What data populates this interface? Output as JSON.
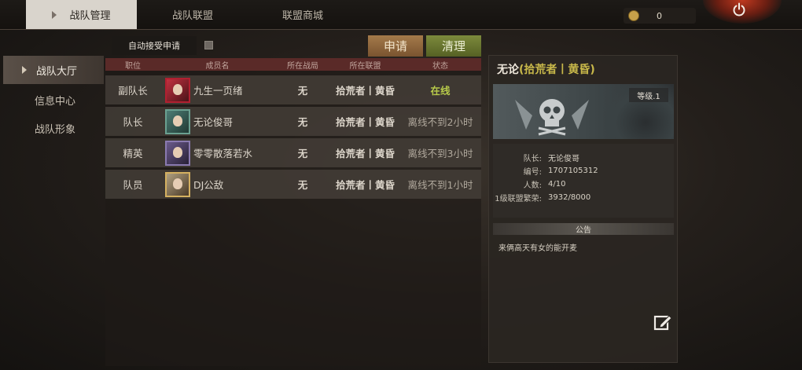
{
  "top_tabs": [
    {
      "label": "战队管理",
      "active": true
    },
    {
      "label": "战队联盟",
      "active": false
    },
    {
      "label": "联盟商城",
      "active": false
    }
  ],
  "currency": {
    "value": "0",
    "icon": "coin-icon"
  },
  "power_icon": "power-icon",
  "sidebar": {
    "items": [
      {
        "label": "战队大厅",
        "active": true
      },
      {
        "label": "信息中心",
        "active": false
      },
      {
        "label": "战队形象",
        "active": false
      }
    ]
  },
  "toolbar": {
    "auto_accept_label": "自动接受申请",
    "auto_accept_checked": false,
    "apply_label": "申请",
    "clear_label": "清理"
  },
  "table": {
    "headers": [
      "职位",
      "成员名",
      "所在战局",
      "所在联盟",
      "状态"
    ],
    "rows": [
      {
        "position": "副队长",
        "name": "九生一页绪",
        "battle": "无",
        "alliance": "拾荒者丨黄昏",
        "status": "在线",
        "online": true
      },
      {
        "position": "队长",
        "name": "无论俊哥",
        "battle": "无",
        "alliance": "拾荒者丨黄昏",
        "status": "离线不到2小时",
        "online": false
      },
      {
        "position": "精英",
        "name": "零零散落若水",
        "battle": "无",
        "alliance": "拾荒者丨黄昏",
        "status": "离线不到3小时",
        "online": false
      },
      {
        "position": "队员",
        "name": "DJ公敌",
        "battle": "无",
        "alliance": "拾荒者丨黄昏",
        "status": "离线不到1小时",
        "online": false
      }
    ]
  },
  "team_panel": {
    "team_name": "无论",
    "alliance_tag": "(拾荒者丨黄昏)",
    "level": "等级.1",
    "info": [
      {
        "label": "队长:",
        "value": "无论俊哥"
      },
      {
        "label": "编号:",
        "value": "1707105312"
      },
      {
        "label": "人数:",
        "value": "4/10"
      },
      {
        "label": "1级联盟繁荣:",
        "value": "3932/8000"
      }
    ],
    "notice_title": "公告",
    "notice_text": "来俩高天有女的能开麦"
  },
  "colors": {
    "online": "#b7c94a",
    "alliance_tag": "#c8b84a",
    "apply_button": "#a47a4a",
    "clear_button": "#7c8a3c",
    "header_bar": "#5a2a28"
  }
}
